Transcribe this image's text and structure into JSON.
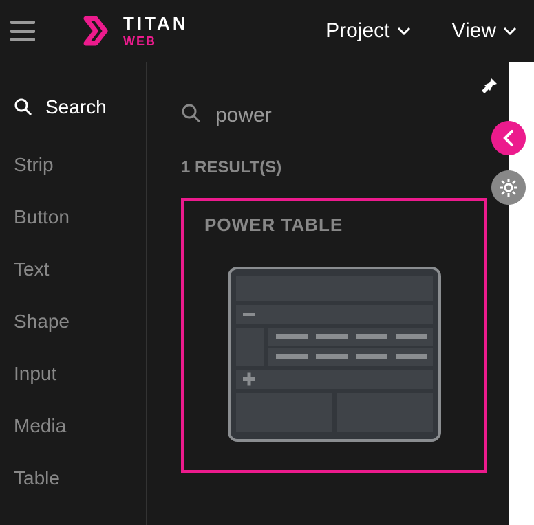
{
  "brand": {
    "title": "TITAN",
    "subtitle": "WEB",
    "accent": "#ec1b8d"
  },
  "header_menu": {
    "project": "Project",
    "view": "View"
  },
  "sidebar": {
    "search_label": "Search",
    "items": [
      "Strip",
      "Button",
      "Text",
      "Shape",
      "Input",
      "Media",
      "Table"
    ]
  },
  "panel": {
    "search_value": "power",
    "results_count": "1 RESULT(S)",
    "result_title": "POWER TABLE"
  }
}
